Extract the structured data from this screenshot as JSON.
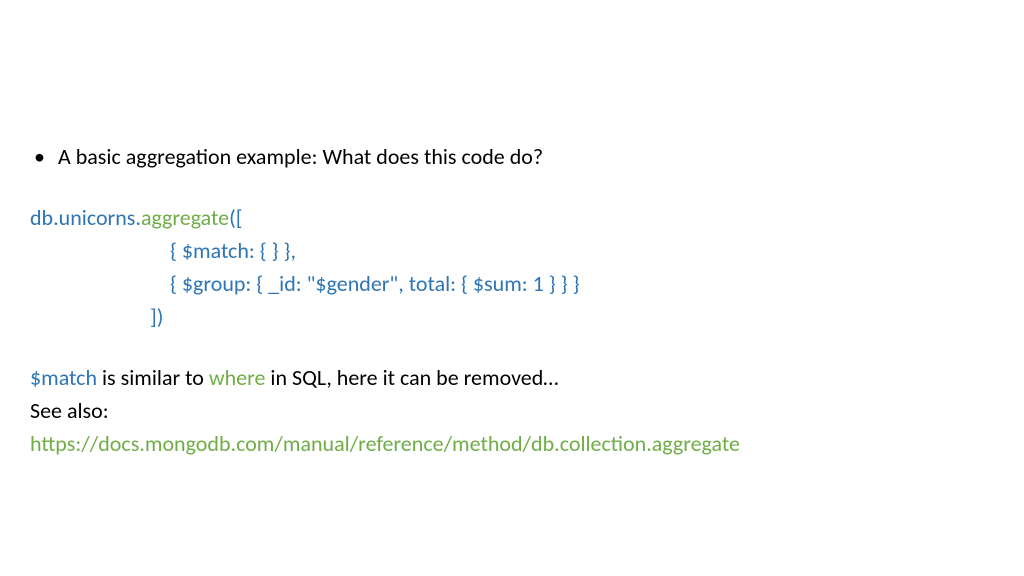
{
  "bullet": {
    "dot": "•",
    "text": "A basic aggregation example: What does this code do?"
  },
  "code": {
    "line1": {
      "dbPrefix": "db.unicorns.",
      "aggregate": "aggregate",
      "tail": "(["
    },
    "line2": "{ $match: { } },",
    "line3": "{ $group: { _id: \"$gender\", total: { $sum: 1 } } }",
    "line4": "])"
  },
  "explain": {
    "match": "$match",
    "mid1": " is similar to ",
    "where": "where",
    "mid2": " in SQL, here it can be removed…",
    "seeAlso": "See also:",
    "link": "https://docs.mongodb.com/manual/reference/method/db.collection.aggregate"
  }
}
